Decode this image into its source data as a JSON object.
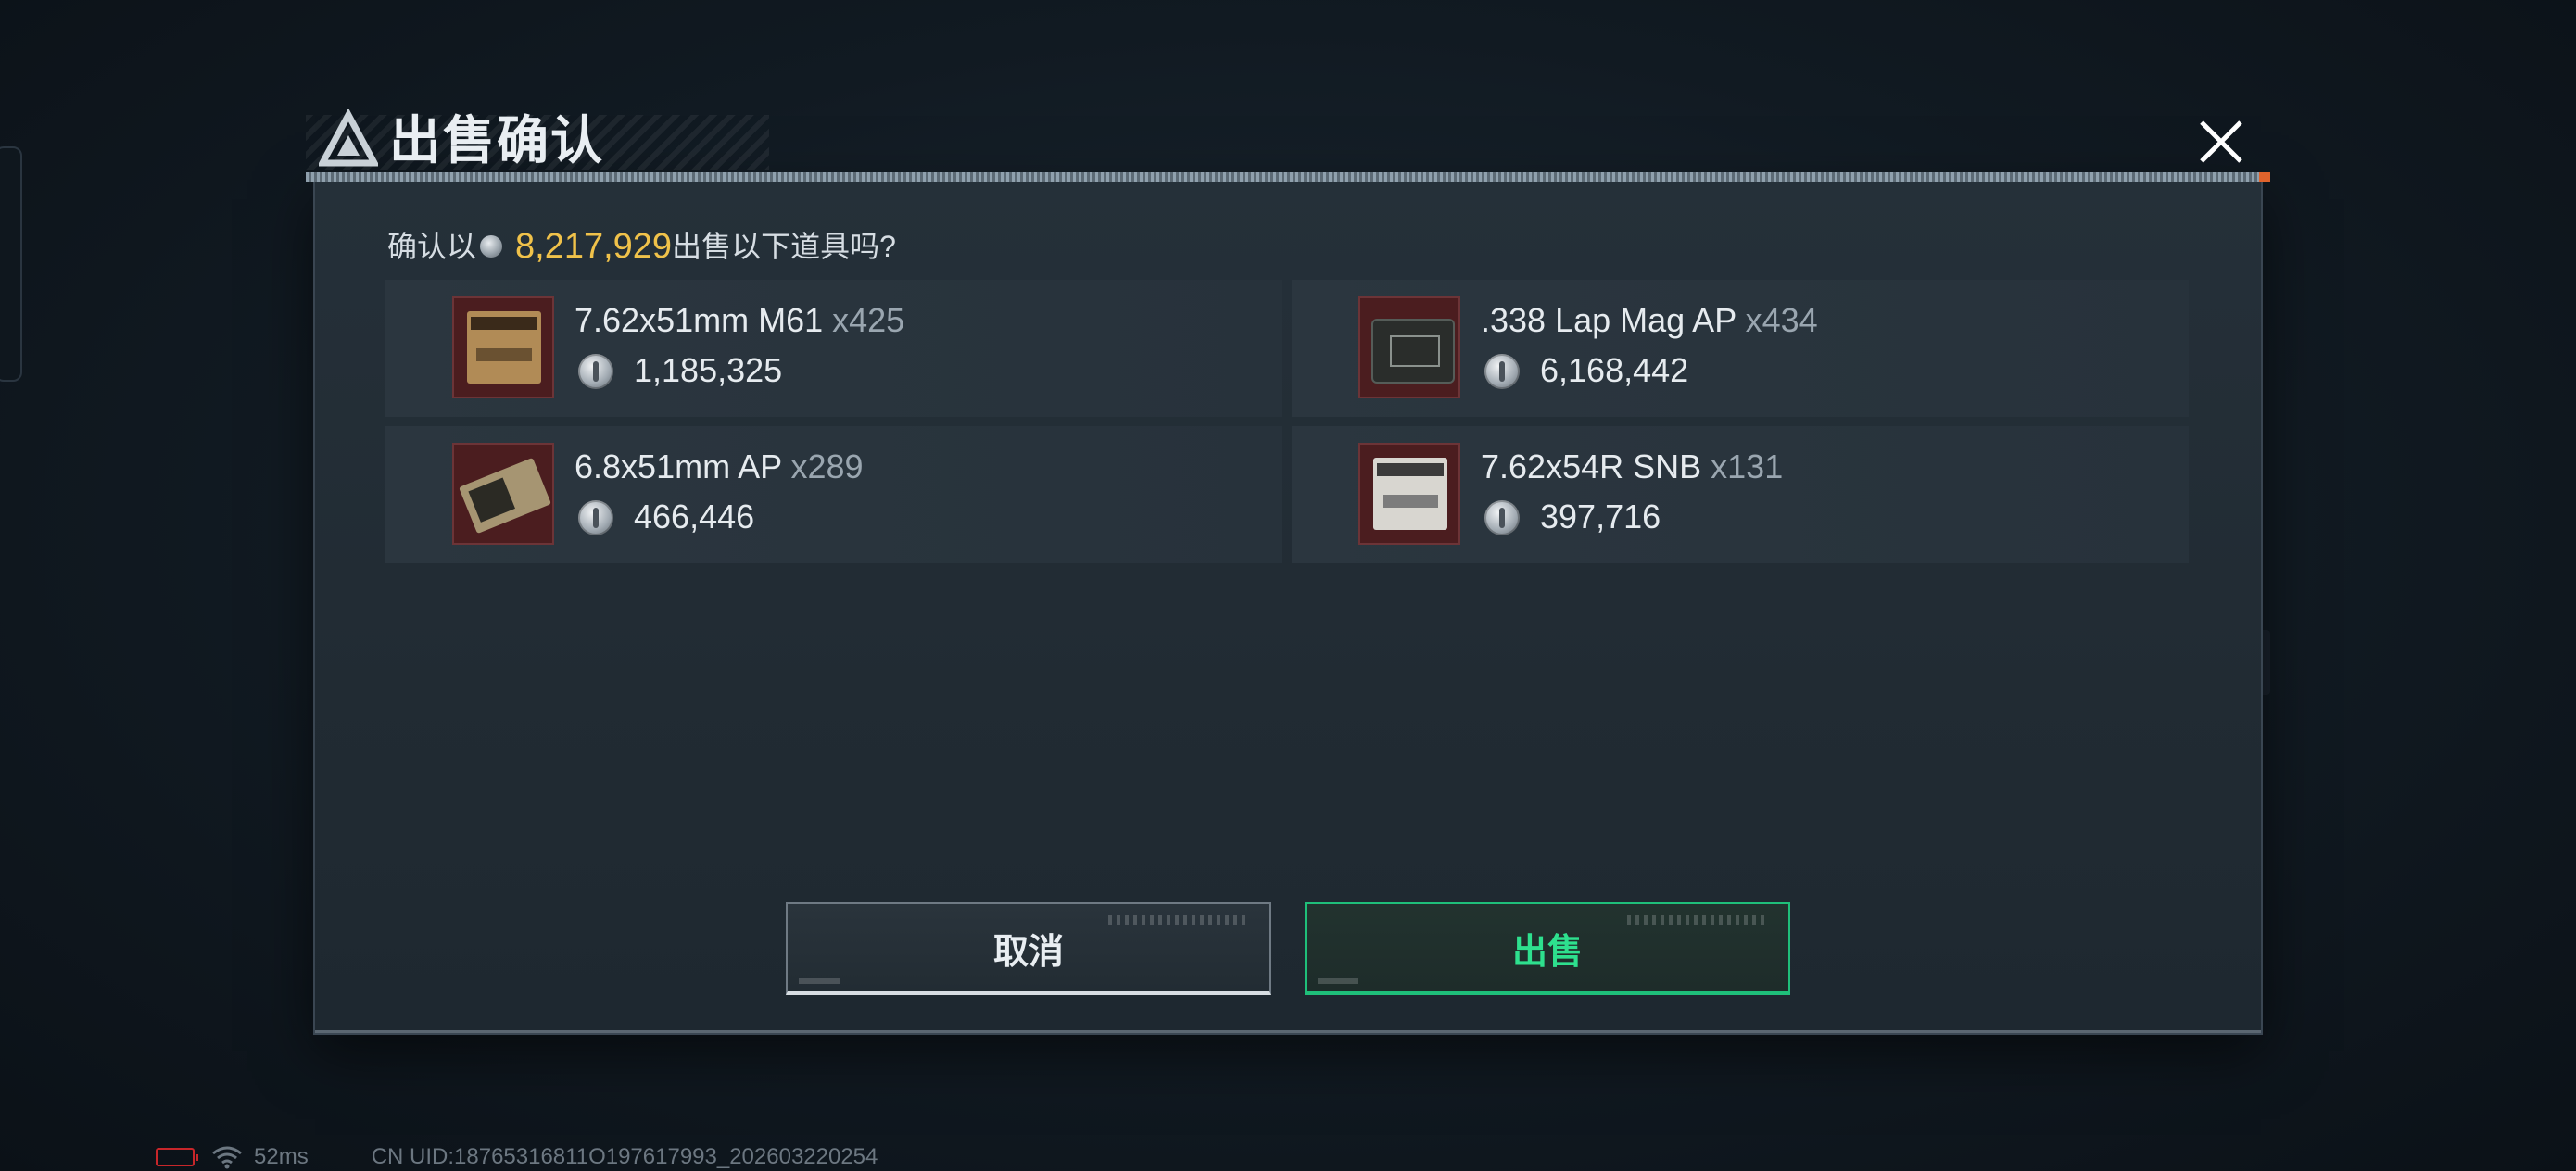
{
  "dialog": {
    "title": "出售确认",
    "close_icon": "close-icon",
    "prompt_prefix": "确认以",
    "prompt_amount": "8,217,929",
    "prompt_suffix": "出售以下道具吗?"
  },
  "items": [
    {
      "name": "7.62x51mm M61",
      "qty": "x425",
      "price": "1,185,325",
      "icon": "ammo-box-icon"
    },
    {
      "name": ".338 Lap Mag AP",
      "qty": "x434",
      "price": "6,168,442",
      "icon": "ammo-case-icon"
    },
    {
      "name": "6.8x51mm AP",
      "qty": "x289",
      "price": "466,446",
      "icon": "ammo-box-icon"
    },
    {
      "name": "7.62x54R SNB",
      "qty": "x131",
      "price": "397,716",
      "icon": "ammo-box-icon"
    }
  ],
  "buttons": {
    "cancel": "取消",
    "sell": "出售"
  },
  "status_bar": {
    "ping": "52ms",
    "uid": "CN UID:18765316811O197617993_202603220254"
  },
  "colors": {
    "accent_gold": "#f0c24a",
    "sell_green": "#2ee08e",
    "battery_red": "#c7262a"
  }
}
